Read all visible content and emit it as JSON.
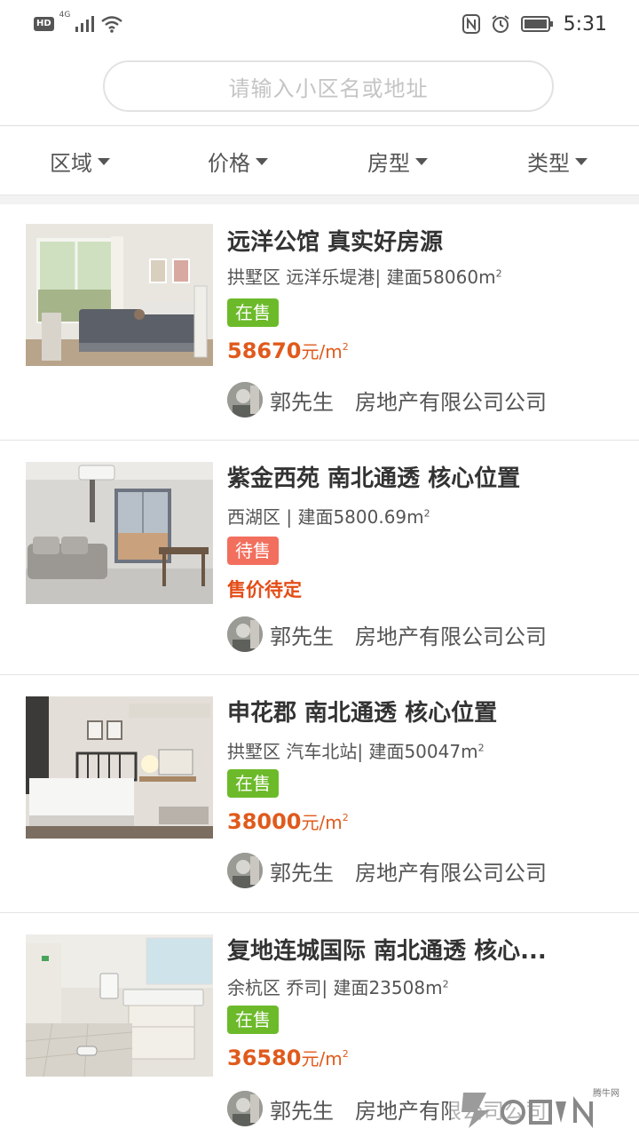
{
  "status_bar": {
    "hd": "HD",
    "network": "4G",
    "time": "5:31",
    "icons": [
      "signal-icon",
      "wifi-icon",
      "nfc-icon",
      "alarm-icon",
      "battery-icon"
    ]
  },
  "search": {
    "placeholder": "请输入小区名或地址"
  },
  "filters": [
    {
      "label": "区域"
    },
    {
      "label": "价格"
    },
    {
      "label": "房型"
    },
    {
      "label": "类型"
    }
  ],
  "listings": [
    {
      "title": "远洋公馆  真实好房源",
      "location": "拱墅区 远洋乐堤港|  建面58060m",
      "area_sup": "2",
      "status": "在售",
      "price": "58670",
      "price_unit": "元/m",
      "price_sup": "2",
      "agent_name": "郭先生",
      "agent_company": "房地产有限公司公司"
    },
    {
      "title": "紫金西苑  南北通透 核心位置",
      "location": "西湖区 |  建面5800.69m",
      "area_sup": "2",
      "status": "待售",
      "price_text": "售价待定",
      "agent_name": "郭先生",
      "agent_company": "房地产有限公司公司"
    },
    {
      "title": "申花郡 南北通透 核心位置",
      "location": "拱墅区 汽车北站|  建面50047m",
      "area_sup": "2",
      "status": "在售",
      "price": "38000",
      "price_unit": "元/m",
      "price_sup": "2",
      "agent_name": "郭先生",
      "agent_company": "房地产有限公司公司"
    },
    {
      "title": "复地连城国际   南北通透 核心...",
      "location": "余杭区 乔司|  建面23508m",
      "area_sup": "2",
      "status": "在售",
      "price": "36580",
      "price_unit": "元/m",
      "price_sup": "2",
      "agent_name": "郭先生",
      "agent_company": "房地产有限公司公司"
    }
  ],
  "colors": {
    "on_sale": "#6cba2a",
    "pending": "#f26f5e",
    "price": "#e05a1c"
  },
  "watermark": "腾牛网"
}
